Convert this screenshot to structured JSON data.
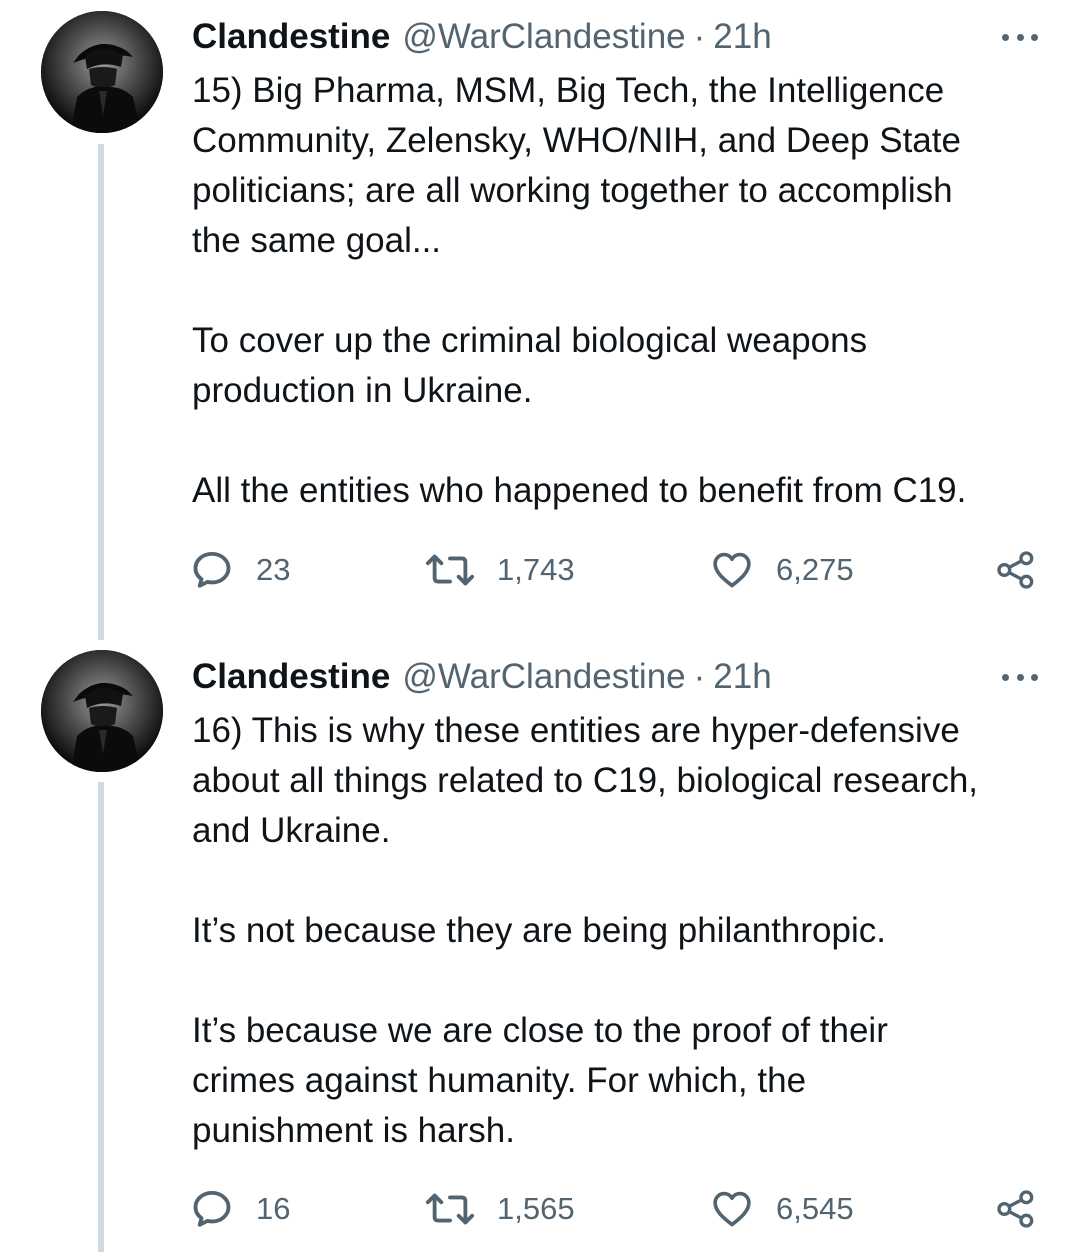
{
  "tweets": [
    {
      "display_name": "Clandestine",
      "handle": "@WarClandestine",
      "separator": "·",
      "time": "21h",
      "paragraphs": [
        "15) Big Pharma, MSM, Big Tech, the Intelligence\nCommunity, Zelensky, WHO/NIH, and Deep State\npoliticians; are all working together to accomplish\nthe same goal...",
        "To cover up the criminal biological weapons\nproduction in Ukraine.",
        "All the entities who happened to benefit from C19."
      ],
      "replies": "23",
      "retweets": "1,743",
      "likes": "6,275"
    },
    {
      "display_name": "Clandestine",
      "handle": "@WarClandestine",
      "separator": "·",
      "time": "21h",
      "paragraphs": [
        "16) This is why these entities are hyper-defensive\nabout all things related to C19, biological research,\nand Ukraine.",
        "It’s not because they are being philanthropic.",
        "It’s because we are close to the proof of their\ncrimes against humanity. For which, the\npunishment is harsh."
      ],
      "replies": "16",
      "retweets": "1,565",
      "likes": "6,545"
    }
  ],
  "icons": {
    "more": "more-icon",
    "reply": "reply-icon",
    "retweet": "retweet-icon",
    "like": "heart-icon",
    "share": "share-icon"
  },
  "colors": {
    "text": "#0f1419",
    "secondary": "#536471",
    "thread_line": "#cfd9de"
  }
}
